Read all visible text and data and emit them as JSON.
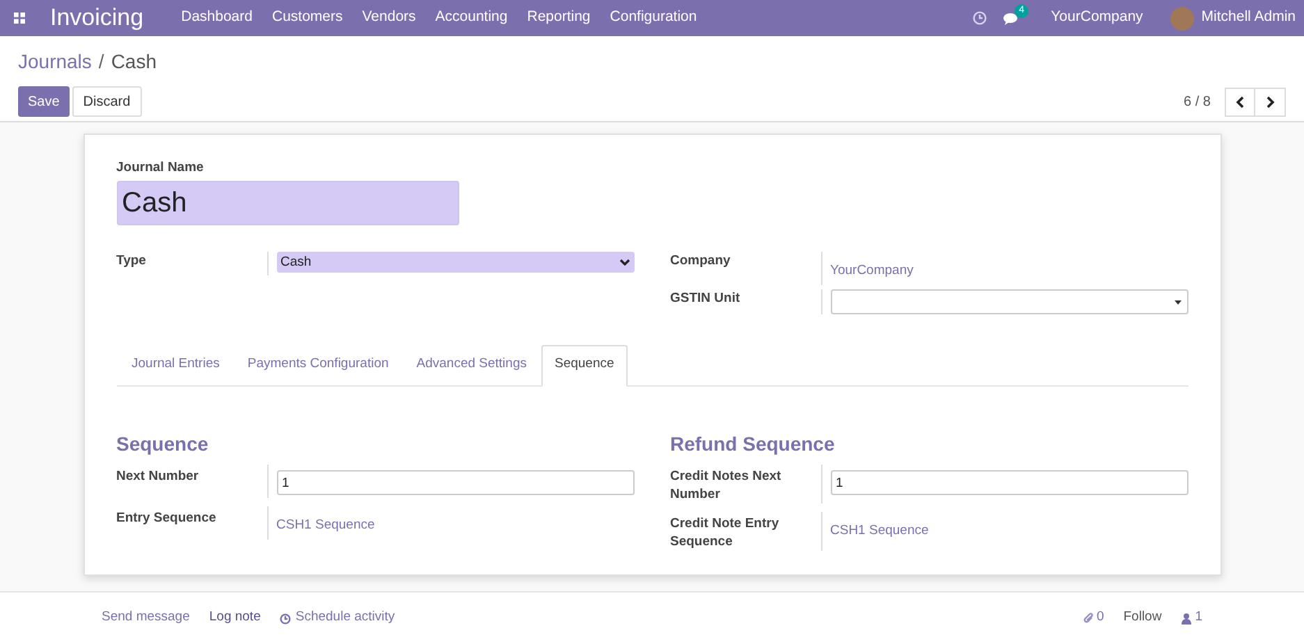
{
  "navbar": {
    "app_name": "Invoicing",
    "menu": [
      "Dashboard",
      "Customers",
      "Vendors",
      "Accounting",
      "Reporting",
      "Configuration"
    ],
    "messages_count": "4",
    "company": "YourCompany",
    "user": "Mitchell Admin"
  },
  "breadcrumb": {
    "parent": "Journals",
    "separator": "/",
    "current": "Cash"
  },
  "buttons": {
    "save": "Save",
    "discard": "Discard"
  },
  "pager": "6 / 8",
  "form": {
    "journal_name_label": "Journal Name",
    "journal_name": "Cash",
    "left_fields": [
      {
        "label": "Type",
        "value": "Cash",
        "kind": "select"
      }
    ],
    "right_fields": [
      {
        "label": "Company",
        "value": "YourCompany",
        "kind": "link"
      },
      {
        "label": "GSTIN Unit",
        "kind": "dropdown"
      }
    ]
  },
  "tabs": [
    {
      "label": "Journal Entries",
      "selected": false
    },
    {
      "label": "Payments Configuration",
      "selected": false
    },
    {
      "label": "Advanced Settings",
      "selected": false
    },
    {
      "label": "Sequence",
      "selected": true
    }
  ],
  "sections": [
    {
      "title": "Sequence",
      "fields": [
        {
          "label": "Next Number",
          "value": "1",
          "kind": "input"
        },
        {
          "label": "Entry Sequence",
          "value": "CSH1 Sequence",
          "kind": "link"
        }
      ]
    },
    {
      "title": "Refund Sequence",
      "fields": [
        {
          "label": "Credit Notes Next Number",
          "value": "1",
          "kind": "input"
        },
        {
          "label": "Credit Note Entry Sequence",
          "value": "CSH1 Sequence",
          "kind": "link"
        }
      ]
    }
  ],
  "chatter": {
    "send_message": "Send message",
    "log_note": "Log note",
    "schedule_activity": "Schedule activity",
    "attachments": "0",
    "follow": "Follow",
    "followers": "1"
  }
}
